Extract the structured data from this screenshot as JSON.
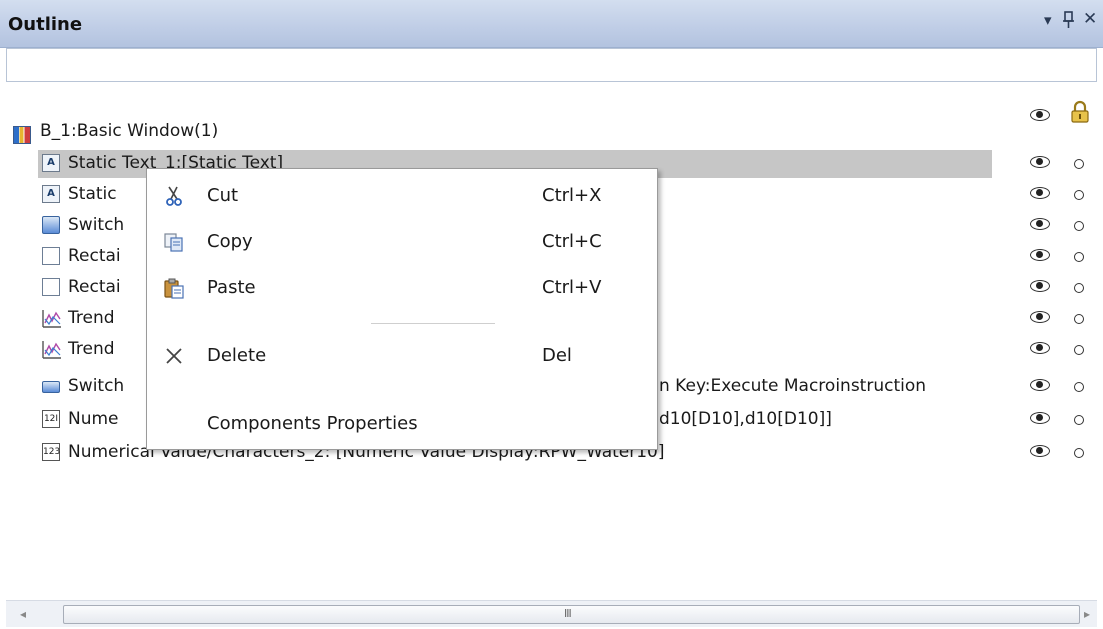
{
  "panel": {
    "title": "Outline",
    "filter_value": "",
    "dropdown_glyph": "▾",
    "pin_glyph": "ᛘ",
    "close_glyph": "✕"
  },
  "tree": {
    "root": {
      "label": "B_1:Basic Window(1)",
      "icon": "window-icon"
    },
    "items": [
      {
        "label": "Static Text_1:[Static Text]",
        "icon": "static-text-icon",
        "selected": true
      },
      {
        "label": "Static",
        "icon": "static-text-icon"
      },
      {
        "label": "Switch",
        "icon": "switch-button-icon"
      },
      {
        "label": "Rectai",
        "icon": "rectangle-icon"
      },
      {
        "label": "Rectai",
        "icon": "rectangle-icon"
      },
      {
        "label": "Trend",
        "icon": "trend-icon"
      },
      {
        "label": "Trend",
        "icon": "trend-icon"
      },
      {
        "label": "Switch",
        "icon": "function-key-icon",
        "tail": "n Key:Execute Macroinstruction"
      },
      {
        "label": "Nume",
        "icon": "numeric-icon",
        "tail": "d10[D10],d10[D10]]"
      },
      {
        "label": "Numerical Value/Characters_2: [Numeric Value Display:RPW_Water10]",
        "icon": "numeric-display-icon"
      }
    ]
  },
  "context_menu": {
    "items": [
      {
        "label": "Cut",
        "shortcut": "Ctrl+X",
        "icon": "scissors-icon"
      },
      {
        "label": "Copy",
        "shortcut": "Ctrl+C",
        "icon": "copy-icon"
      },
      {
        "label": "Paste",
        "shortcut": "Ctrl+V",
        "icon": "paste-icon"
      },
      {
        "label": "Delete",
        "shortcut": "Del",
        "icon": "delete-icon"
      },
      {
        "label": "Components Properties",
        "shortcut": "",
        "icon": ""
      }
    ]
  },
  "scrollbar": {
    "left_arrow": "◂",
    "right_arrow": "▸",
    "grip": "III"
  }
}
